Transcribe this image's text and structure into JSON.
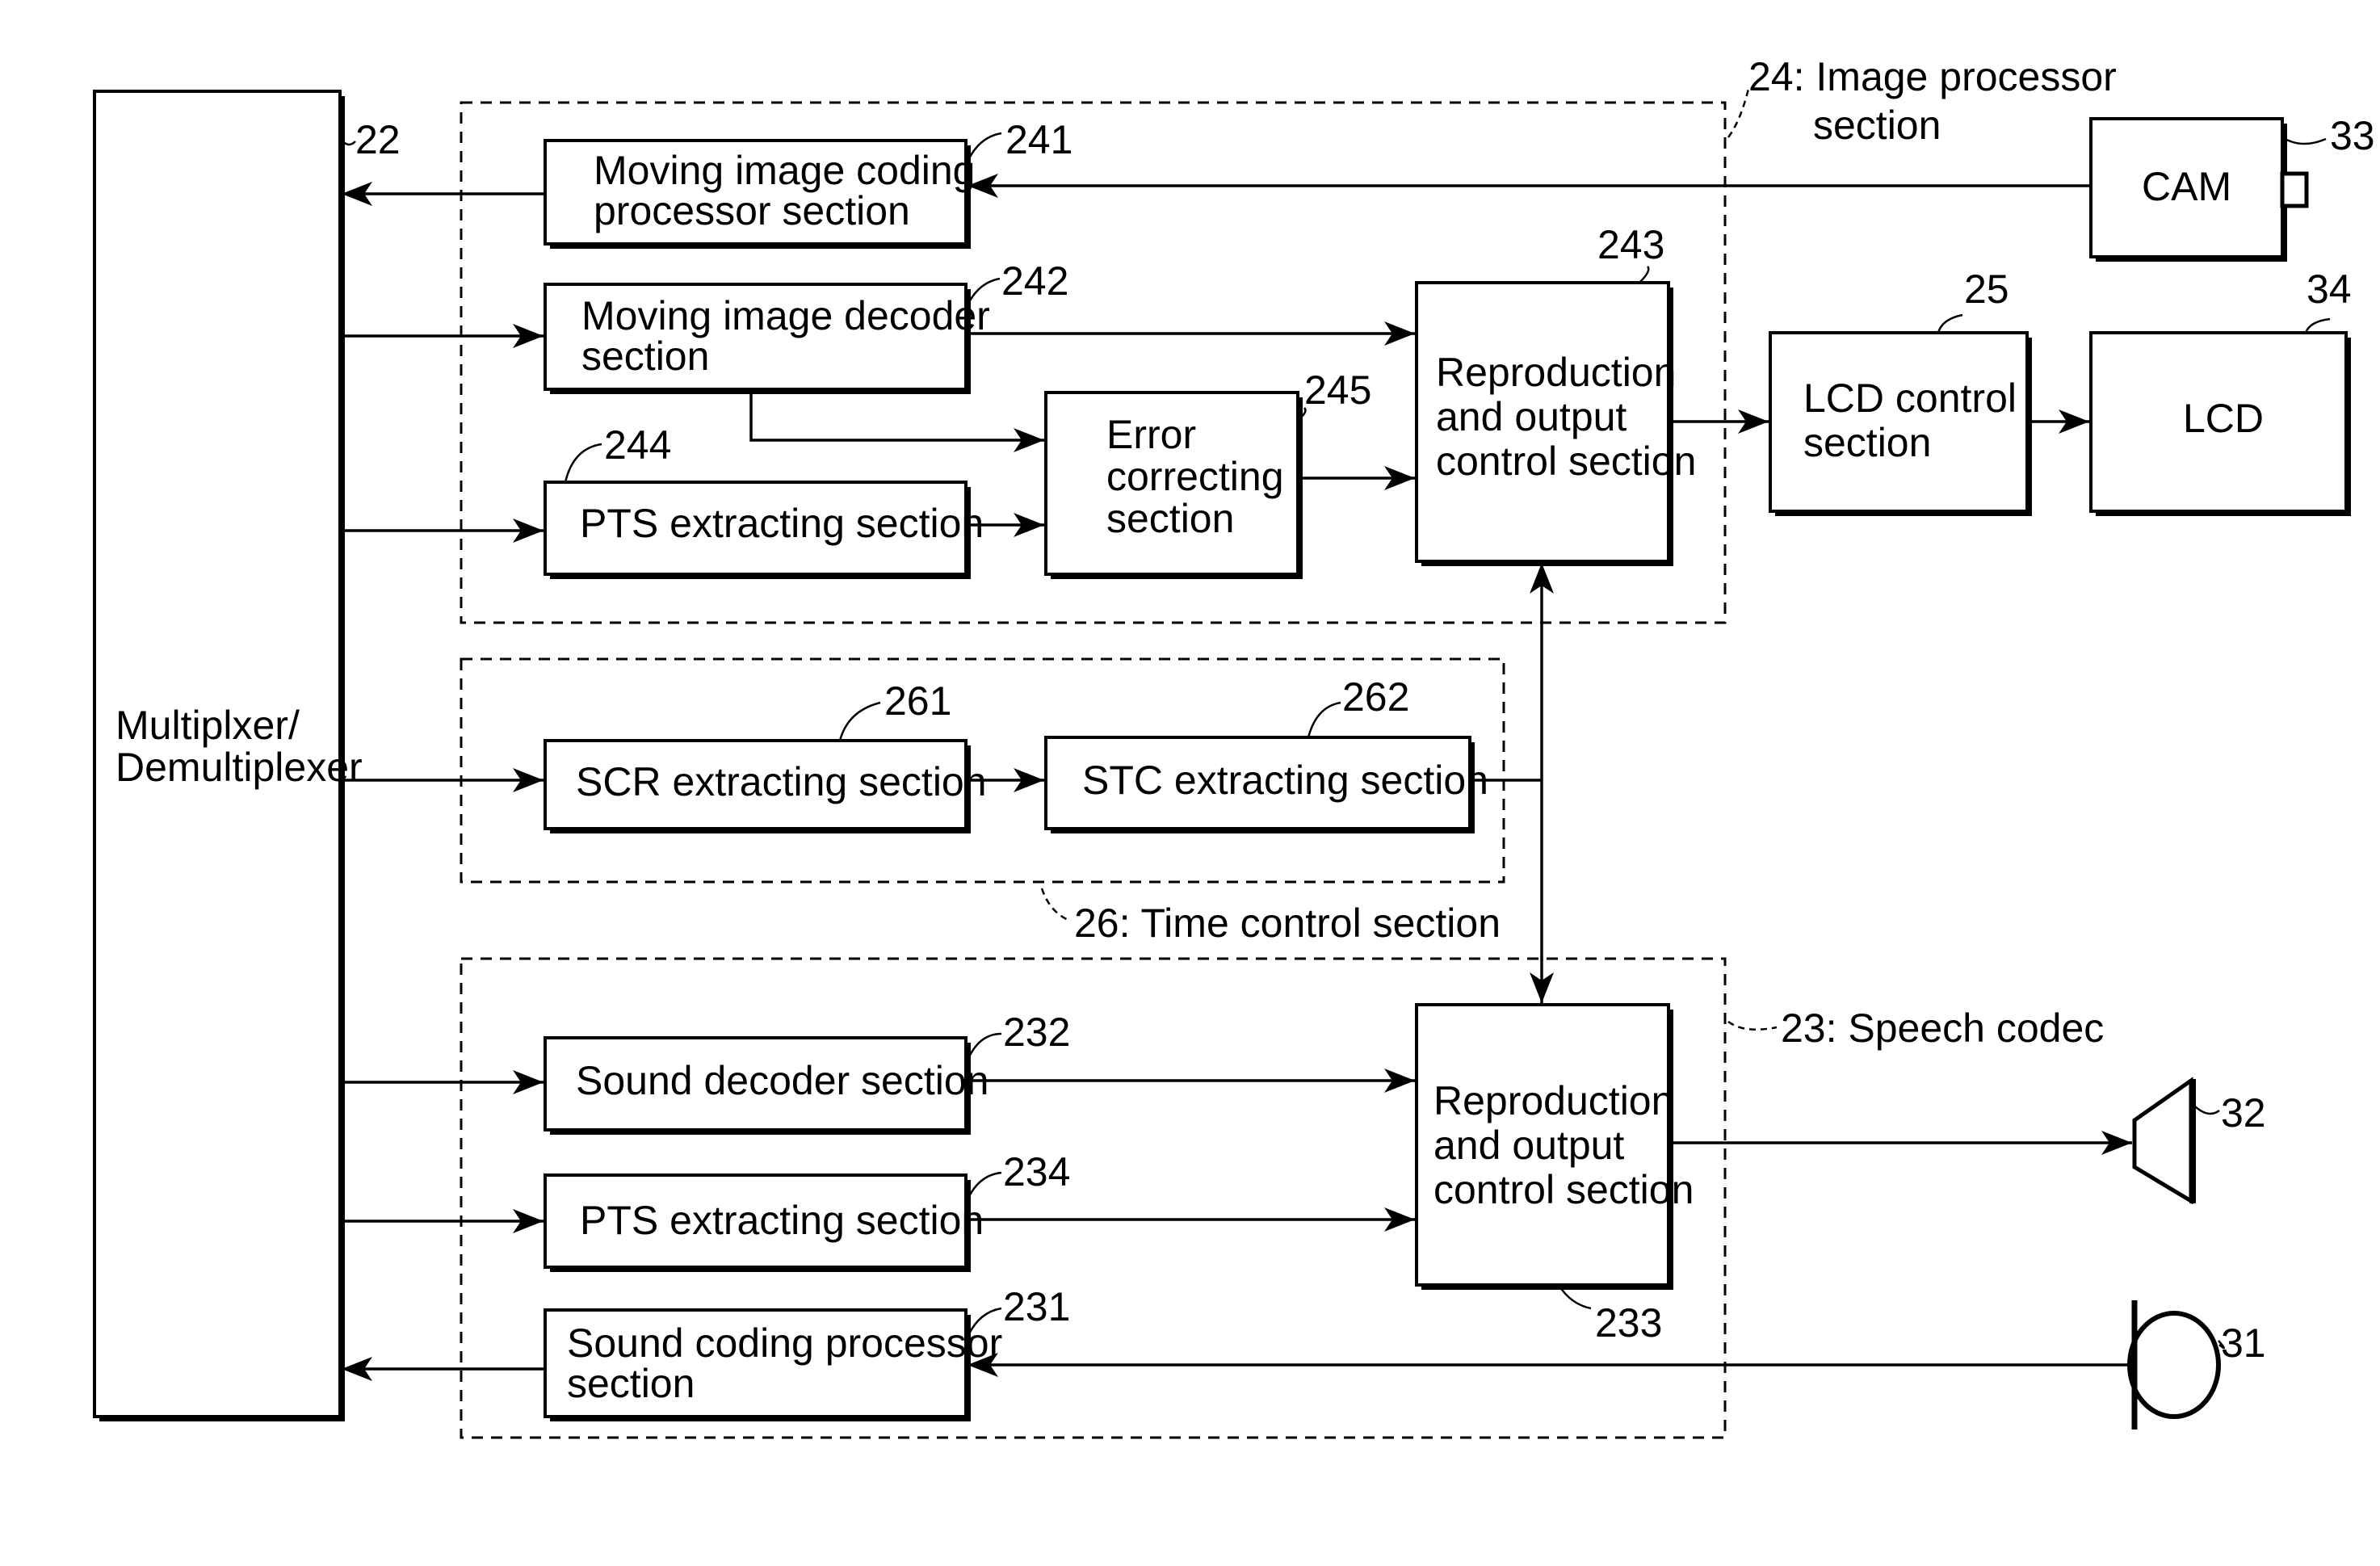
{
  "diagram": {
    "blocks": {
      "mux": {
        "ref": "22",
        "lines": [
          "Multiplxer/",
          "Demultiplexer"
        ]
      },
      "b241": {
        "ref": "241",
        "lines": [
          "Moving  image coding",
          "processor  section"
        ]
      },
      "b242": {
        "ref": "242",
        "lines": [
          "Moving  image decoder",
          "section"
        ]
      },
      "b244": {
        "ref": "244",
        "lines": [
          "PTS  extracting  section"
        ]
      },
      "b245": {
        "ref": "245",
        "lines": [
          "Error",
          "correcting",
          "section"
        ]
      },
      "b243": {
        "ref": "243",
        "lines": [
          "Reproduction",
          "and  output",
          "control  section"
        ]
      },
      "b25": {
        "ref": "25",
        "lines": [
          "LCD  control",
          "section"
        ]
      },
      "lcd": {
        "ref": "34",
        "lines": [
          "LCD"
        ]
      },
      "cam": {
        "ref": "33",
        "lines": [
          "CAM"
        ]
      },
      "b261": {
        "ref": "261",
        "lines": [
          "SCR  extracting  section"
        ]
      },
      "b262": {
        "ref": "262",
        "lines": [
          "STC  extracting  section"
        ]
      },
      "b232": {
        "ref": "232",
        "lines": [
          "Sound  decoder  section"
        ]
      },
      "b234": {
        "ref": "234",
        "lines": [
          "PTS  extracting  section"
        ]
      },
      "b231": {
        "ref": "231",
        "lines": [
          "Sound  coding  processor",
          "section"
        ]
      },
      "b233": {
        "ref": "233",
        "lines": [
          "Reproduction",
          "and  output",
          "control  section"
        ]
      },
      "speaker": {
        "ref": "32"
      },
      "mic": {
        "ref": "31"
      }
    },
    "groups": {
      "g24": {
        "lines": [
          "24:  Image  processor",
          "section"
        ]
      },
      "g26": {
        "lines": [
          "26:  Time  control  section"
        ]
      },
      "g23": {
        "lines": [
          "23:  Speech  codec"
        ]
      }
    }
  }
}
